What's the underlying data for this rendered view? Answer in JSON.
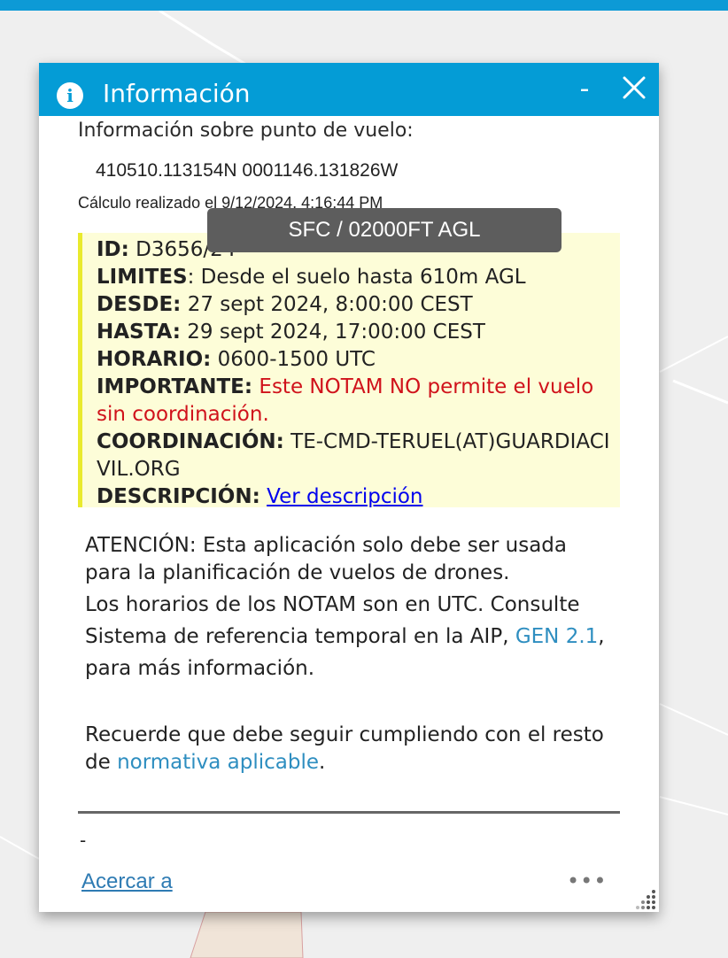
{
  "popup": {
    "title": "Información",
    "minimize_label": "-",
    "subtitle": "Información sobre punto de vuelo:",
    "coordinates": "410510.113154N 0001146.131826W",
    "calculation": "Cálculo realizado el 9/12/2024, 4:16:44 PM",
    "tooltip": "SFC / 02000FT AGL",
    "notam": {
      "id_label": "ID:",
      "id_value": "D3656/24",
      "limites_label": "LIMITES",
      "limites_value": ": Desde el suelo hasta 610m AGL",
      "desde_label": "DESDE:",
      "desde_value": "27 sept 2024, 8:00:00 CEST",
      "hasta_label": "HASTA:",
      "hasta_value": "29 sept 2024, 17:00:00 CEST",
      "horario_label": "HORARIO:",
      "horario_value": "0600-1500 UTC",
      "importante_label": "IMPORTANTE:",
      "importante_value": "Este NOTAM NO permite el vuelo sin coordinación.",
      "coordinacion_label": "COORDINACIÓN:",
      "coordinacion_value": "TE-CMD-TERUEL(AT)GUARDIACIVIL.ORG",
      "descripcion_label": "DESCRIPCIÓN:",
      "descripcion_link": "Ver descripción"
    },
    "attention": "ATENCIÓN: Esta aplicación solo debe ser usada para la planificación de vuelos de drones.",
    "utc_text_before": "Los horarios de los NOTAM son en UTC. Consulte Sistema de referencia temporal en la AIP, ",
    "utc_link": "GEN 2.1",
    "utc_text_after": ", para más información.",
    "normativa_before": "Recuerde que debe seguir cumpliendo con el resto de ",
    "normativa_link": "normativa aplicable",
    "normativa_after": ".",
    "dash": "-",
    "zoom_link": "Acercar a",
    "more": "•••"
  }
}
